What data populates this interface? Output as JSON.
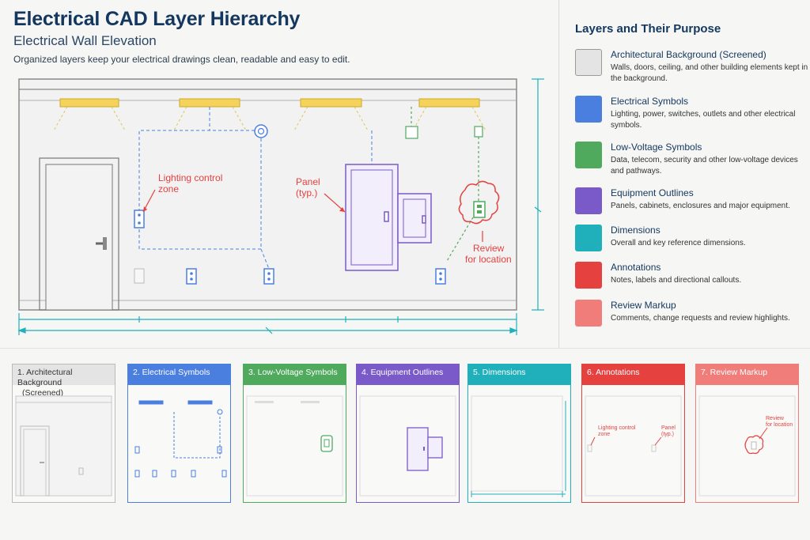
{
  "header": {
    "title": "Electrical CAD Layer Hierarchy",
    "subtitle": "Electrical Wall Elevation",
    "description": "Organized layers keep your electrical drawings clean, readable and easy to edit."
  },
  "drawing": {
    "callouts": {
      "lighting_1": "Lighting control",
      "lighting_2": "zone",
      "panel_1": "Panel",
      "panel_2": "(typ.)",
      "review_1": "Review",
      "review_2": "for location"
    }
  },
  "legend": {
    "heading": "Layers and Their Purpose",
    "items": [
      {
        "title": "Architectural Background (Screened)",
        "description": "Walls, doors, ceiling, and other building elements kept in the background.",
        "color": "#e4e4e4",
        "border": "#9a9a9a"
      },
      {
        "title": "Electrical Symbols",
        "description": "Lighting, power, switches, outlets and other electrical symbols.",
        "color": "#4a7fe0",
        "border": "#4a7fe0"
      },
      {
        "title": "Low-Voltage Symbols",
        "description": "Data, telecom, security and other low-voltage devices and pathways.",
        "color": "#4faa5e",
        "border": "#4faa5e"
      },
      {
        "title": "Equipment Outlines",
        "description": "Panels, cabinets, enclosures and major equipment.",
        "color": "#7a5ac8",
        "border": "#7a5ac8"
      },
      {
        "title": "Dimensions",
        "description": "Overall and key reference dimensions.",
        "color": "#1fb0bb",
        "border": "#1fb0bb"
      },
      {
        "title": "Annotations",
        "description": "Notes, labels and directional callouts.",
        "color": "#e5413f",
        "border": "#e5413f"
      },
      {
        "title": "Review Markup",
        "description": "Comments, change requests and review highlights.",
        "color": "#f07d7a",
        "border": "#f07d7a"
      }
    ]
  },
  "panels": [
    {
      "label_1": "1. Architectural Background",
      "label_2": "(Screened)",
      "color": "#e4e4e4",
      "text_color": "#333333"
    },
    {
      "label_1": "2. Electrical Symbols",
      "label_2": "",
      "color": "#4a7fe0",
      "text_color": "#ffffff"
    },
    {
      "label_1": "3. Low-Voltage Symbols",
      "label_2": "",
      "color": "#4faa5e",
      "text_color": "#ffffff"
    },
    {
      "label_1": "4. Equipment Outlines",
      "label_2": "",
      "color": "#7a5ac8",
      "text_color": "#ffffff"
    },
    {
      "label_1": "5. Dimensions",
      "label_2": "",
      "color": "#1fb0bb",
      "text_color": "#ffffff"
    },
    {
      "label_1": "6. Annotations",
      "label_2": "",
      "color": "#e5413f",
      "text_color": "#ffffff"
    },
    {
      "label_1": "7. Review Markup",
      "label_2": "",
      "color": "#f07d7a",
      "text_color": "#ffffff"
    }
  ],
  "panel_annotations": {
    "lighting_1": "Lighting control",
    "lighting_2": "zone",
    "panel_1": "Panel",
    "panel_2": "(typ.)",
    "review_1": "Review",
    "review_2": "for location"
  }
}
